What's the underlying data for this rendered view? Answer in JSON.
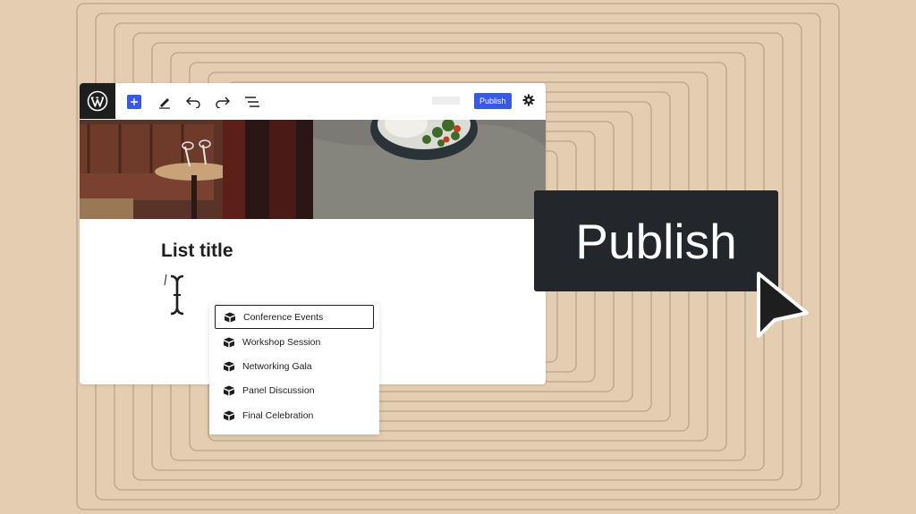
{
  "toolbar": {
    "publish_label": "Publish",
    "icons": [
      "wordpress-logo",
      "plus-icon",
      "pencil-icon",
      "undo-icon",
      "redo-icon",
      "list-view-icon",
      "gear-icon"
    ]
  },
  "content": {
    "list_title": "List title"
  },
  "dropdown": {
    "items": [
      {
        "label": "Conference Events",
        "selected": true
      },
      {
        "label": "Workshop Session",
        "selected": false
      },
      {
        "label": "Networking Gala",
        "selected": false
      },
      {
        "label": "Panel Discussion",
        "selected": false
      },
      {
        "label": "Final Celebration",
        "selected": false
      }
    ]
  },
  "callout": {
    "publish_label": "Publish"
  },
  "colors": {
    "background": "#e4cdb1",
    "lines": "#b9a48c",
    "accent": "#3858e9",
    "dark": "#23272b"
  }
}
